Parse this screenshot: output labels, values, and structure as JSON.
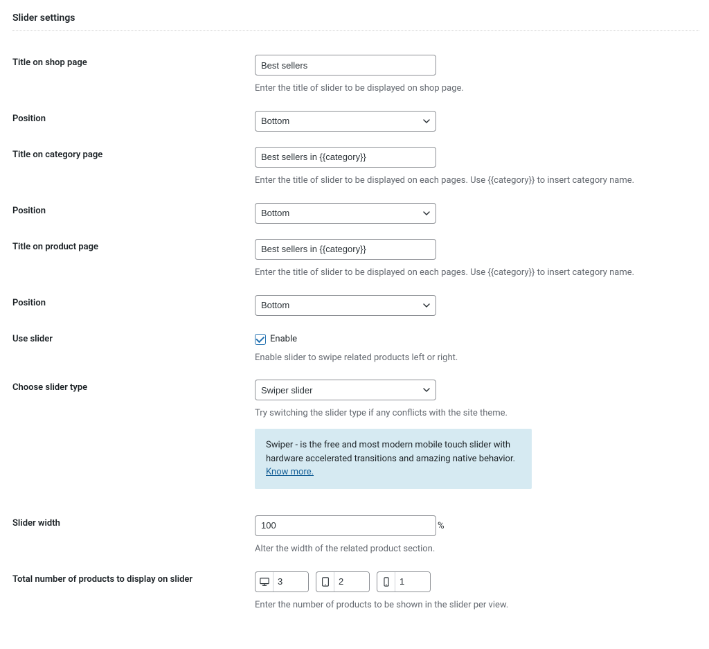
{
  "section_title": "Slider settings",
  "fields": {
    "title_shop": {
      "label": "Title on shop page",
      "value": "Best sellers",
      "desc": "Enter the title of slider to be displayed on shop page."
    },
    "position1": {
      "label": "Position",
      "value": "Bottom"
    },
    "title_category": {
      "label": "Title on category page",
      "value": "Best sellers in {{category}}",
      "desc": "Enter the title of slider to be displayed on each pages. Use {{category}} to insert category name."
    },
    "position2": {
      "label": "Position",
      "value": "Bottom"
    },
    "title_product": {
      "label": "Title on product page",
      "value": "Best sellers in {{category}}",
      "desc": "Enter the title of slider to be displayed on each pages. Use {{category}} to insert category name."
    },
    "position3": {
      "label": "Position",
      "value": "Bottom"
    },
    "use_slider": {
      "label": "Use slider",
      "checkbox_label": "Enable",
      "desc": "Enable slider to swipe related products left or right."
    },
    "slider_type": {
      "label": "Choose slider type",
      "value": "Swiper slider",
      "desc": "Try switching the slider type if any conflicts with the site theme.",
      "info_text": "Swiper - is the free and most modern mobile touch slider with hardware accelerated transitions and amazing native behavior. ",
      "info_link": "Know more."
    },
    "slider_width": {
      "label": "Slider width",
      "value": "100",
      "unit": "%",
      "desc": "Alter the width of the related product section."
    },
    "products_per_view": {
      "label": "Total number of products to display on slider",
      "desktop": "3",
      "tablet": "2",
      "mobile": "1",
      "desc": "Enter the number of products to be shown in the slider per view."
    }
  }
}
